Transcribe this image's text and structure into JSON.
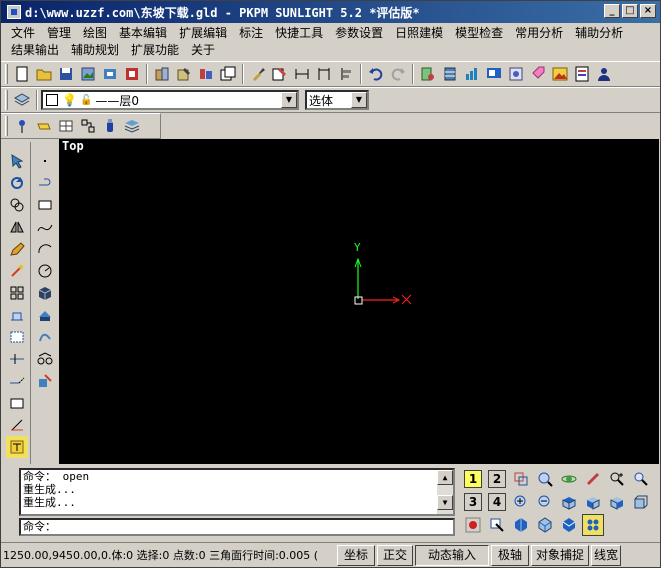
{
  "window": {
    "title": "d:\\www.uzzf.com\\东坡下载.gld - PKPM SUNLIGHT 5.2 *评估版*",
    "minimize": "_",
    "maximize": "□",
    "close": "×"
  },
  "menu": {
    "row1": [
      "文件",
      "管理",
      "绘图",
      "基本编辑",
      "扩展编辑",
      "标注",
      "快捷工具",
      "参数设置",
      "日照建模",
      "模型检查",
      "常用分析",
      "辅助分析"
    ],
    "row2": [
      "结果输出",
      "辅助规划",
      "扩展功能",
      "关于"
    ]
  },
  "layer_toolbar": {
    "layer_name": "——层0",
    "select_mode": "选体"
  },
  "viewport": {
    "label": "Top",
    "axis_y": "Y",
    "background": "#000000",
    "x_axis_color": "#ff2020",
    "y_axis_color": "#20ff20"
  },
  "command": {
    "history": [
      "命令： open",
      "重生成...",
      "重生成..."
    ],
    "prompt": "命令："
  },
  "view_panel": {
    "buttons": [
      "1",
      "2",
      "3",
      "4"
    ],
    "active": "1"
  },
  "status": {
    "coords": "1250.00,9450.00,0.体:0 选择:0 点数:0 三角面行时间:0.005 (",
    "buttons": [
      "坐标",
      "正交",
      "动态输入",
      "极轴",
      "对象捕捉",
      "线宽"
    ]
  }
}
